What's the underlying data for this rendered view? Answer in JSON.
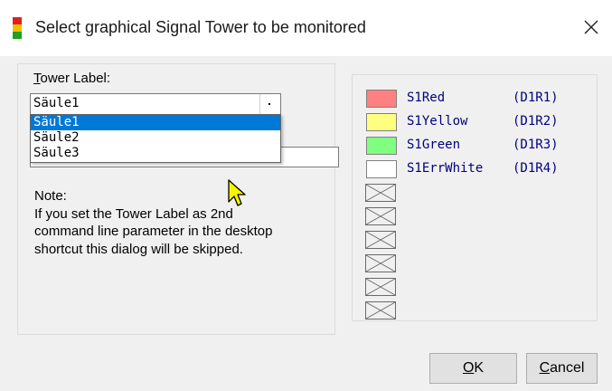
{
  "window": {
    "title": "Select graphical Signal Tower to be monitored",
    "close_glyph": "✕",
    "icon": "signal-tower-icon",
    "icon_colors": [
      "#e02020",
      "#f0c000",
      "#20a020"
    ]
  },
  "left": {
    "tower_label_mnemonic": "T",
    "tower_label_rest": "ower Label:",
    "combo_value": "Säule1",
    "dropdown_options": [
      "Säule1",
      "Säule2",
      "Säule3"
    ],
    "dropdown_selected_index": 0,
    "note_title": "Note:",
    "note_lines": [
      "If you set the Tower Label as 2nd",
      "command line parameter in the desktop",
      "shortcut this dialog will be skipped."
    ]
  },
  "signals": [
    {
      "name": "S1Red",
      "code": "(D1R1)",
      "color": "#ff8080"
    },
    {
      "name": "S1Yellow",
      "code": "(D1R2)",
      "color": "#ffff80"
    },
    {
      "name": "S1Green",
      "code": "(D1R3)",
      "color": "#80ff80"
    },
    {
      "name": "S1ErrWhite",
      "code": "(D1R4)",
      "color": "#ffffff"
    }
  ],
  "empty_slots": 6,
  "buttons": {
    "ok_mnemonic": "O",
    "ok_rest": "K",
    "cancel_mnemonic": "C",
    "cancel_rest": "ancel"
  }
}
